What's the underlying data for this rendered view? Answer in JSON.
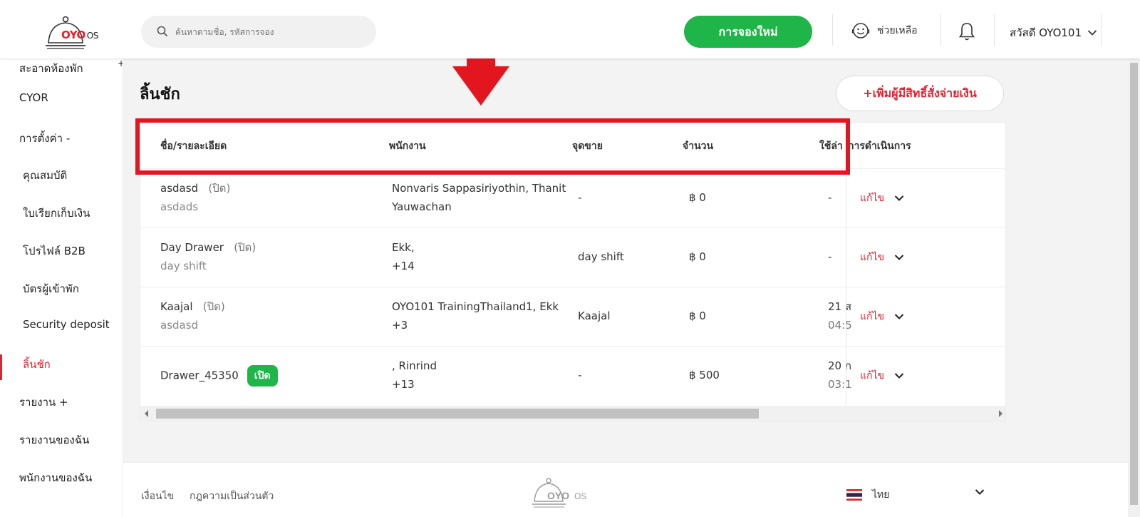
{
  "header": {
    "logo_text": "OYO",
    "logo_os": "OS",
    "search_placeholder": "ค้นหาตามชื่อ, รหัสการจอง",
    "new_booking_label": "การจองใหม่",
    "help_label": "ช่วยเหลือ",
    "user_greeting": "สวัสดี OYO101"
  },
  "sidebar": {
    "items": [
      {
        "label": "สะอาดห้องพัก"
      },
      {
        "label": "CYOR"
      },
      {
        "label": "การตั้งค่า   -"
      },
      {
        "label": "คุณสมบัติ"
      },
      {
        "label": "ใบเรียกเก็บเงิน"
      },
      {
        "label": "โปรไฟล์ B2B"
      },
      {
        "label": "บัตรผู้เข้าพัก"
      },
      {
        "label": "Security deposit"
      },
      {
        "label": "ลิ้นชัก"
      },
      {
        "label": "รายงาน    +"
      },
      {
        "label": "รายงานของฉัน"
      },
      {
        "label": "พนักงานของฉัน"
      }
    ]
  },
  "main": {
    "title": "ลิ้นชัก",
    "add_button": "+เพิ่มผู้มีสิทธิ์สั่งจ่ายเงิน",
    "columns": [
      "ชื่อ/รายละเอียด",
      "พนักงาน",
      "จุดขาย",
      "จำนวน",
      "ใช้ล่า",
      "การดำเนินการ"
    ],
    "rows": [
      {
        "name": "asdasd",
        "status": "(ปิด)",
        "detail": "asdads",
        "staff1": "Nonvaris Sappasiriyothin, Thanit",
        "staff2": "Yauwachan",
        "pos": "-",
        "amount": "฿ 0",
        "last1": "-",
        "last2": "",
        "action": "แก้ไข"
      },
      {
        "name": "Day Drawer",
        "status": "(ปิด)",
        "detail": "day shift",
        "staff1": "Ekk,",
        "staff2": "+14",
        "pos": "day shift",
        "amount": "฿ 0",
        "last1": "-",
        "last2": "",
        "action": "แก้ไข"
      },
      {
        "name": "Kaajal",
        "status": "(ปิด)",
        "detail": "asdasd",
        "staff1": "OYO101 TrainingThailand1, Ekk",
        "staff2": "+3",
        "pos": "Kaajal",
        "amount": "฿ 0",
        "last1": "21 ส",
        "last2": "04:5",
        "action": "แก้ไข"
      },
      {
        "name": "Drawer_45350",
        "status": "เปิด",
        "detail": "",
        "staff1": ", Rinrind",
        "staff2": "+13",
        "pos": "-",
        "amount": "฿ 500",
        "last1": "20 ก",
        "last2": "03:1",
        "action": "แก้ไข"
      }
    ]
  },
  "footer": {
    "terms": "เงื่อนไข",
    "privacy": "กฎความเป็นส่วนตัว",
    "language": "ไทย"
  },
  "colors": {
    "brand_red": "#e6212d",
    "green": "#1fb548",
    "highlight": "#e3161f"
  }
}
